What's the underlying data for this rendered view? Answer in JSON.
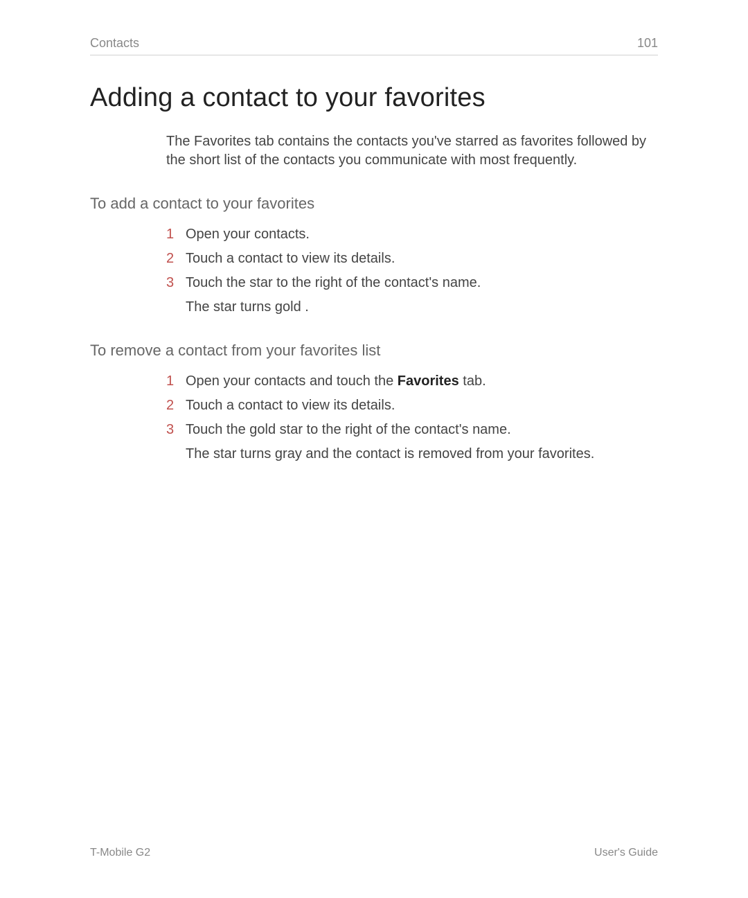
{
  "header": {
    "section": "Contacts",
    "pageNumber": "101"
  },
  "title": "Adding a contact to your favorites",
  "intro": "The Favorites tab contains the contacts you've starred as favorites followed by the short list of the contacts you communicate with most frequently.",
  "section1": {
    "heading": "To add a contact to your favorites",
    "steps": {
      "n1": "1",
      "t1": "Open your contacts.",
      "n2": "2",
      "t2": "Touch a contact to view its details.",
      "n3": "3",
      "t3": "Touch the star to the right of the contact's name.",
      "sub3": "The star turns gold   ."
    }
  },
  "section2": {
    "heading": "To remove a contact from your favorites list",
    "steps": {
      "n1": "1",
      "t1_a": "Open your contacts and touch the ",
      "t1_bold": "Favorites",
      "t1_b": "  tab.",
      "n2": "2",
      "t2": "Touch a contact to view its details.",
      "n3": "3",
      "t3": "Touch the gold star to the right of the contact's name.",
      "sub3": "The star turns gray and the contact is removed from your favorites."
    }
  },
  "footer": {
    "left": "T-Mobile G2",
    "right": "User's Guide"
  }
}
